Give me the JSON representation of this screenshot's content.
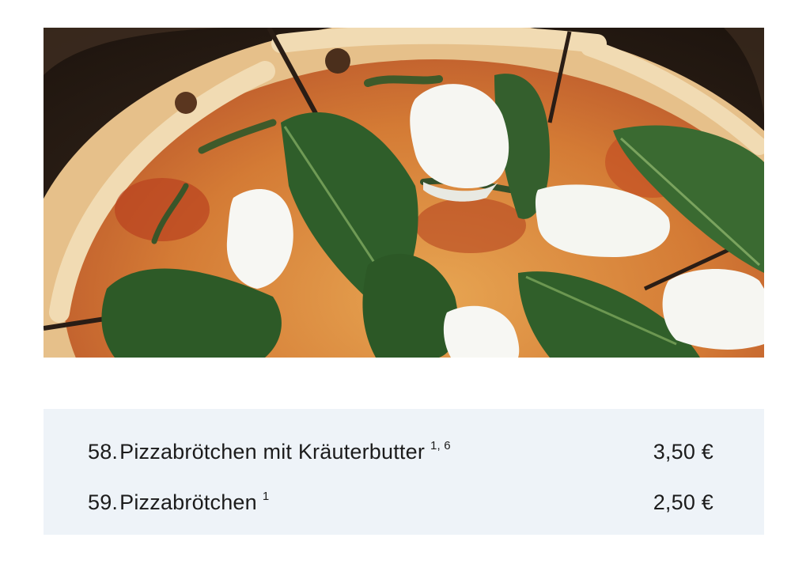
{
  "photo": {
    "subject": "pizza with rocket, burrata and pesto on a wooden board",
    "colors": {
      "board": "#2a1d15",
      "crust": "#e9c89a",
      "sauce": "#c5582c",
      "cheese": "#e4a25a",
      "greens": "#2f5e2a",
      "burrata": "#f6f6f2"
    }
  },
  "menu": {
    "background_color": "#eef3f8",
    "items": [
      {
        "number": "58.",
        "name": "Pizzabrötchen mit Kräuterbutter",
        "note": "1, 6",
        "price": "3,50 €"
      },
      {
        "number": "59.",
        "name": "Pizzabrötchen",
        "note": "1",
        "price": "2,50 €"
      }
    ]
  }
}
